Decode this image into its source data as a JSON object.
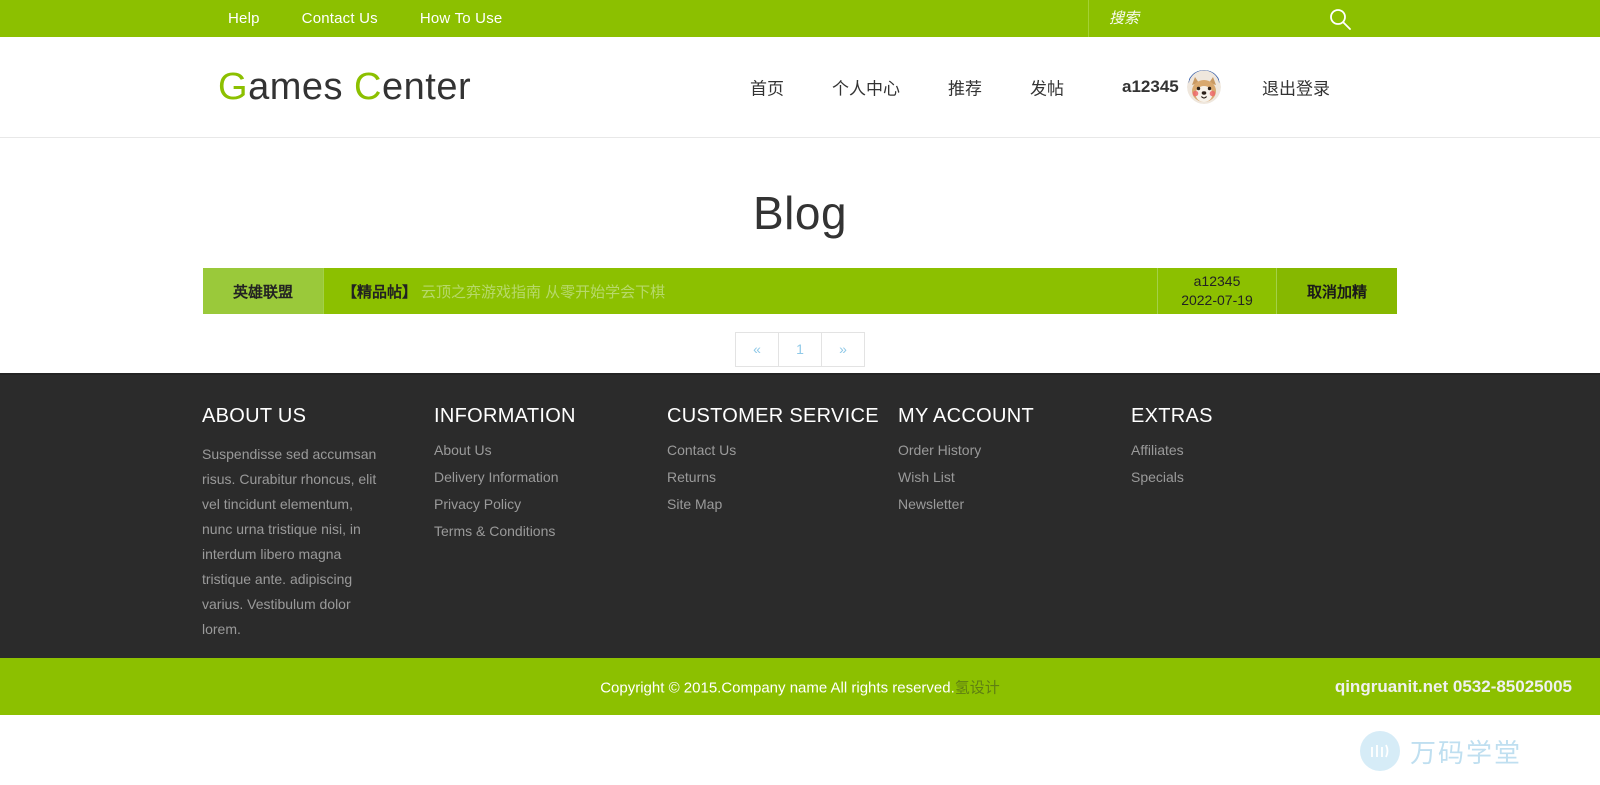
{
  "topbar": {
    "links": [
      {
        "label": "Help",
        "name": "topbar-link-help"
      },
      {
        "label": "Contact Us",
        "name": "topbar-link-contact-us"
      },
      {
        "label": "How To Use",
        "name": "topbar-link-how-to-use"
      }
    ],
    "search": {
      "placeholder": "搜索",
      "value": "",
      "icon": "search-icon"
    },
    "background_color": "#8cc000"
  },
  "header": {
    "logo": {
      "g1": "G",
      "part1": "ames ",
      "g2": "C",
      "part2": "enter",
      "accent_color": "#8cc000"
    },
    "nav": [
      {
        "label": "首页",
        "name": "nav-item-home"
      },
      {
        "label": "个人中心",
        "name": "nav-item-profile"
      },
      {
        "label": "推荐",
        "name": "nav-item-recommend"
      },
      {
        "label": "发帖",
        "name": "nav-item-post"
      }
    ],
    "user": {
      "name": "a12345",
      "avatar": "dog-avatar"
    },
    "logout_label": "退出登录"
  },
  "main": {
    "page_title": "Blog",
    "post": {
      "game": "英雄联盟",
      "tag": "【精品帖】",
      "title": "云顶之弈游戏指南 从零开始学会下棋",
      "author": "a12345",
      "date": "2022-07-19",
      "action_label": "取消加精"
    },
    "pagination": {
      "prev": "«",
      "pages": [
        "1"
      ],
      "next": "»",
      "current": "1"
    }
  },
  "footer": {
    "columns": [
      {
        "title": "ABOUT US",
        "text": "Suspendisse sed accumsan risus. Curabitur rhoncus, elit vel tincidunt elementum, nunc urna tristique nisi, in interdum libero magna tristique ante. adipiscing varius. Vestibulum dolor lorem.",
        "links": []
      },
      {
        "title": "INFORMATION",
        "text": "",
        "links": [
          "About Us",
          "Delivery Information",
          "Privacy Policy",
          "Terms & Conditions"
        ]
      },
      {
        "title": "CUSTOMER SERVICE",
        "text": "",
        "links": [
          "Contact Us",
          "Returns",
          "Site Map"
        ]
      },
      {
        "title": "MY ACCOUNT",
        "text": "",
        "links": [
          "Order History",
          "Wish List",
          "Newsletter"
        ]
      },
      {
        "title": "EXTRAS",
        "text": "",
        "links": [
          "Affiliates",
          "Specials"
        ]
      }
    ],
    "background_color": "#2b2b2b"
  },
  "bottombar": {
    "copyright_en": "Copyright © 2015.Company name All rights reserved.",
    "copyright_cn": "氢设计",
    "contact": "qingruanit.net 0532-85025005"
  },
  "watermark": {
    "text": "万码学堂"
  }
}
